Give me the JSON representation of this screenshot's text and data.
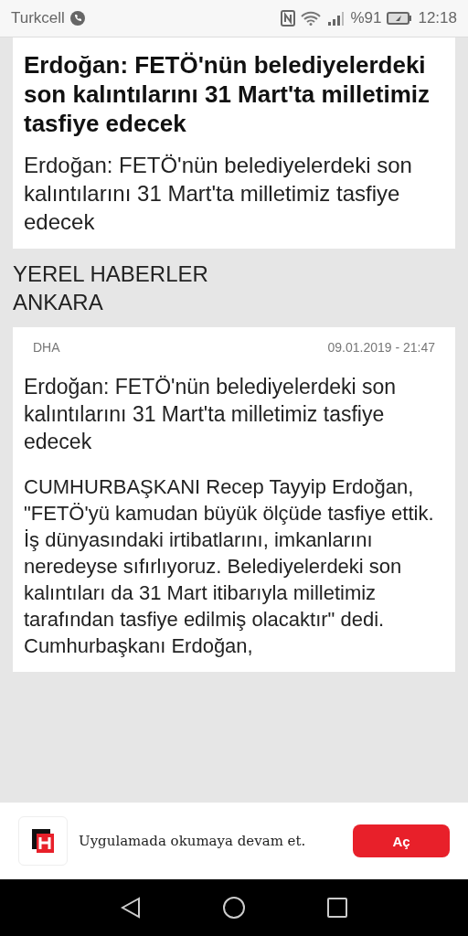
{
  "status_bar": {
    "carrier": "Turkcell",
    "battery": "%91",
    "time": "12:18"
  },
  "top_card": {
    "title": "Erdoğan: FETÖ'nün belediyelerdeki son kalıntılarını 31 Mart'ta milletimiz tasfiye edecek",
    "summary": "Erdoğan: FETÖ'nün belediyelerdeki son kalıntılarını 31 Mart'ta milletimiz tasfiye edecek"
  },
  "section": {
    "category": "YEREL HABERLER",
    "city": "ANKARA"
  },
  "article": {
    "source": "DHA",
    "date": "09.01.2019 - 21:47",
    "headline": "Erdoğan: FETÖ'nün belediyelerdeki son kalıntılarını 31 Mart'ta milletimiz tasfiye edecek",
    "body": "CUMHURBAŞKANI Recep Tayyip Erdoğan, \"FETÖ'yü kamudan büyük ölçüde tasfiye ettik. İş dünyasındaki irtibatlarını, imkanlarını neredeyse sıfırlıyoruz. Belediyelerdeki son kalıntıları da 31 Mart itibarıyla milletimiz tarafından tasfiye edilmiş olacaktır\" dedi. Cumhurbaşkanı Erdoğan,"
  },
  "app_banner": {
    "message": "Uygulamada okumaya devam et.",
    "button": "Aç"
  }
}
